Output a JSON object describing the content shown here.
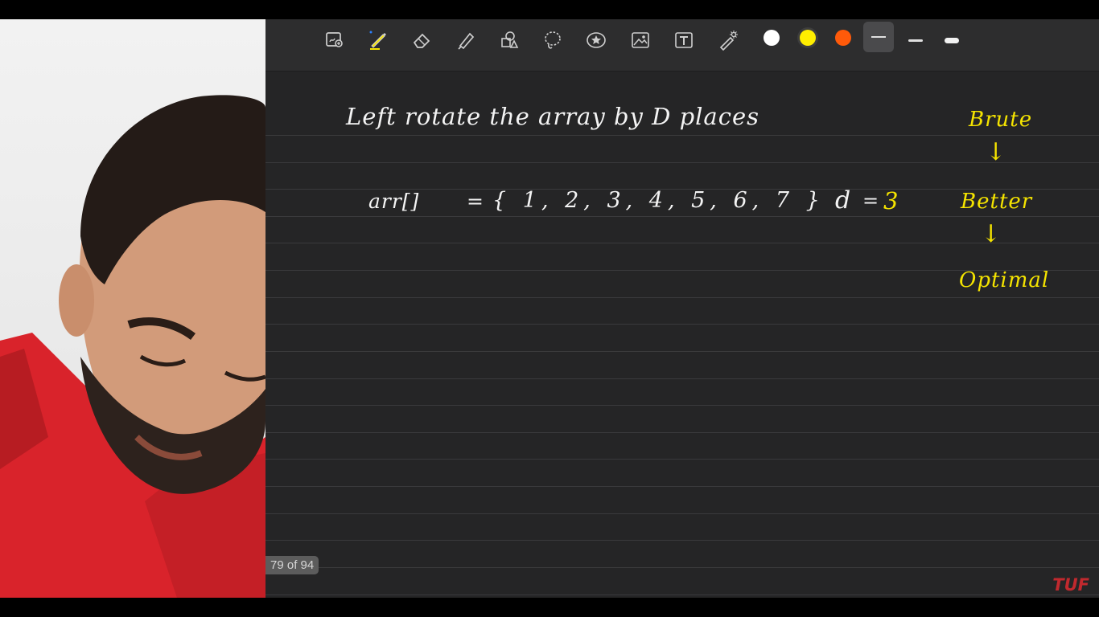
{
  "toolbar": {
    "tools": [
      {
        "name": "scan-icon",
        "label": ""
      },
      {
        "name": "pen-icon",
        "label": ""
      },
      {
        "name": "eraser-icon",
        "label": ""
      },
      {
        "name": "highlighter-icon",
        "label": ""
      },
      {
        "name": "shapes-icon",
        "label": ""
      },
      {
        "name": "lasso-icon",
        "label": ""
      },
      {
        "name": "sticker-icon",
        "label": ""
      },
      {
        "name": "image-icon",
        "label": ""
      },
      {
        "name": "text-icon",
        "label": ""
      },
      {
        "name": "laser-pointer-icon",
        "label": ""
      }
    ],
    "colors": [
      "#ffffff",
      "#ffee00",
      "#ff5a0a"
    ],
    "selected_color": "#ffee00",
    "stroke_widths": [
      "thin",
      "medium",
      "thick"
    ]
  },
  "note": {
    "title_line": "Left rotate the array by D places",
    "array_label": "arr[]",
    "array_eq": "=",
    "array_values": "{ 1, 2, 3, 4, 5, 6, 7 }",
    "d_label": "d",
    "d_eq": "=",
    "d_value": "3",
    "approaches": [
      "Brute",
      "Better",
      "Optimal"
    ],
    "arrow": "↓"
  },
  "page_counter": "79 of 94",
  "watermark": "TUF"
}
